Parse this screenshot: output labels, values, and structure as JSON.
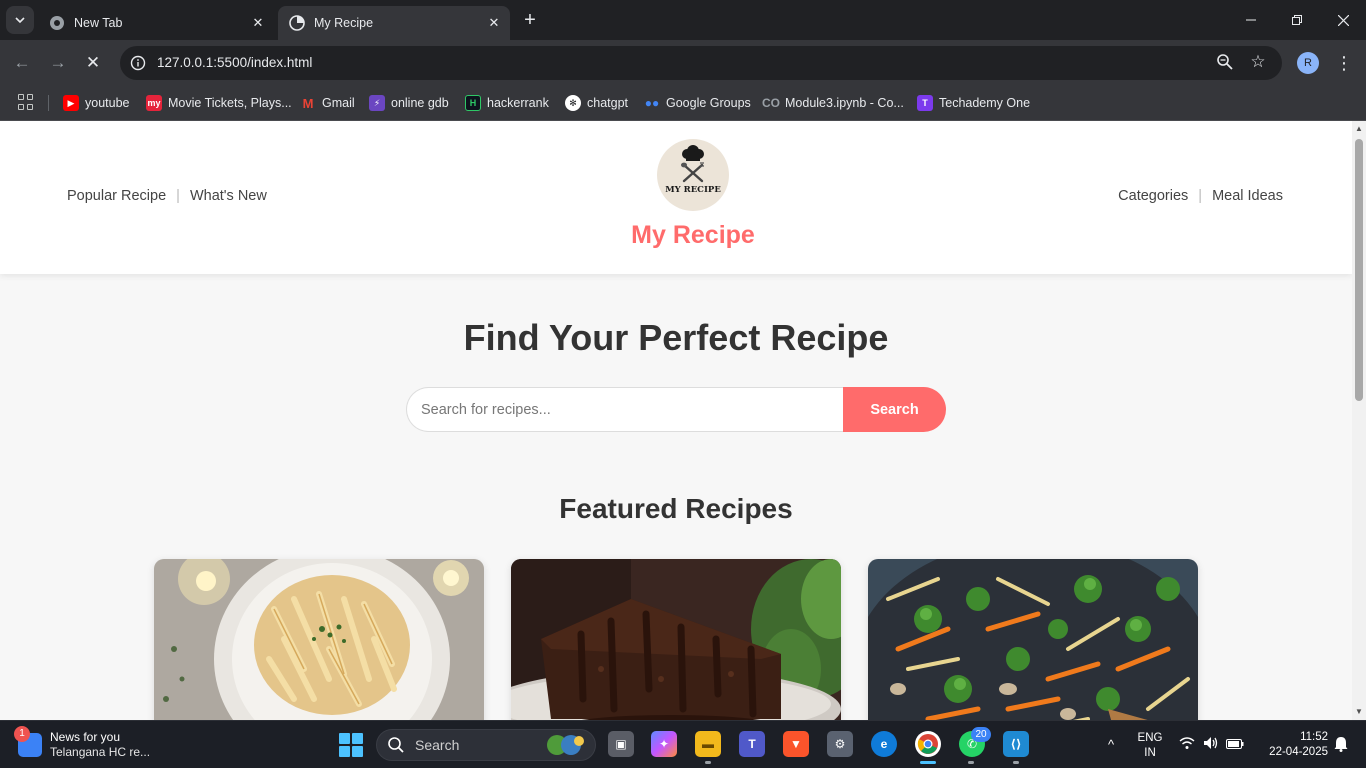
{
  "browser": {
    "tabs": [
      {
        "title": "New Tab",
        "active": false
      },
      {
        "title": "My Recipe",
        "active": true
      }
    ],
    "url": "127.0.0.1:5500/index.html",
    "profile_initial": "R",
    "bookmarks": [
      {
        "label": "youtube",
        "icon": "youtube-icon",
        "color": "#ff0000"
      },
      {
        "label": "Movie Tickets, Plays...",
        "icon": "bookmyshow-icon",
        "color": "#e5243b"
      },
      {
        "label": "Gmail",
        "icon": "gmail-icon",
        "color": "#ea4335"
      },
      {
        "label": "online gdb",
        "icon": "onlinegdb-icon",
        "color": "#6b46c1"
      },
      {
        "label": "hackerrank",
        "icon": "hackerrank-icon",
        "color": "#0e141e"
      },
      {
        "label": "chatgpt",
        "icon": "chatgpt-icon",
        "color": "#ffffff"
      },
      {
        "label": "Google Groups",
        "icon": "google-groups-icon",
        "color": "#4285f4"
      },
      {
        "label": "Module3.ipynb - Co...",
        "icon": "colab-icon",
        "color": "#9aa0a6"
      },
      {
        "label": "Techademy One",
        "icon": "techademy-icon",
        "color": "#7c3aed"
      }
    ]
  },
  "site": {
    "nav_left": [
      "Popular Recipe",
      "What's New"
    ],
    "nav_right": [
      "Categories",
      "Meal Ideas"
    ],
    "logo_text": "MY RECIPE",
    "title": "My Recipe",
    "hero_title": "Find Your Perfect Recipe",
    "search_placeholder": "Search for recipes...",
    "search_button": "Search",
    "featured_title": "Featured Recipes",
    "accent_color": "#ff6b6b"
  },
  "taskbar": {
    "news_title": "News for you",
    "news_subtitle": "Telangana HC re...",
    "news_badge": "1",
    "search_label": "Search",
    "whatsapp_badge": "20",
    "language": "ENG",
    "region": "IN",
    "time": "11:52",
    "date": "22-04-2025"
  }
}
